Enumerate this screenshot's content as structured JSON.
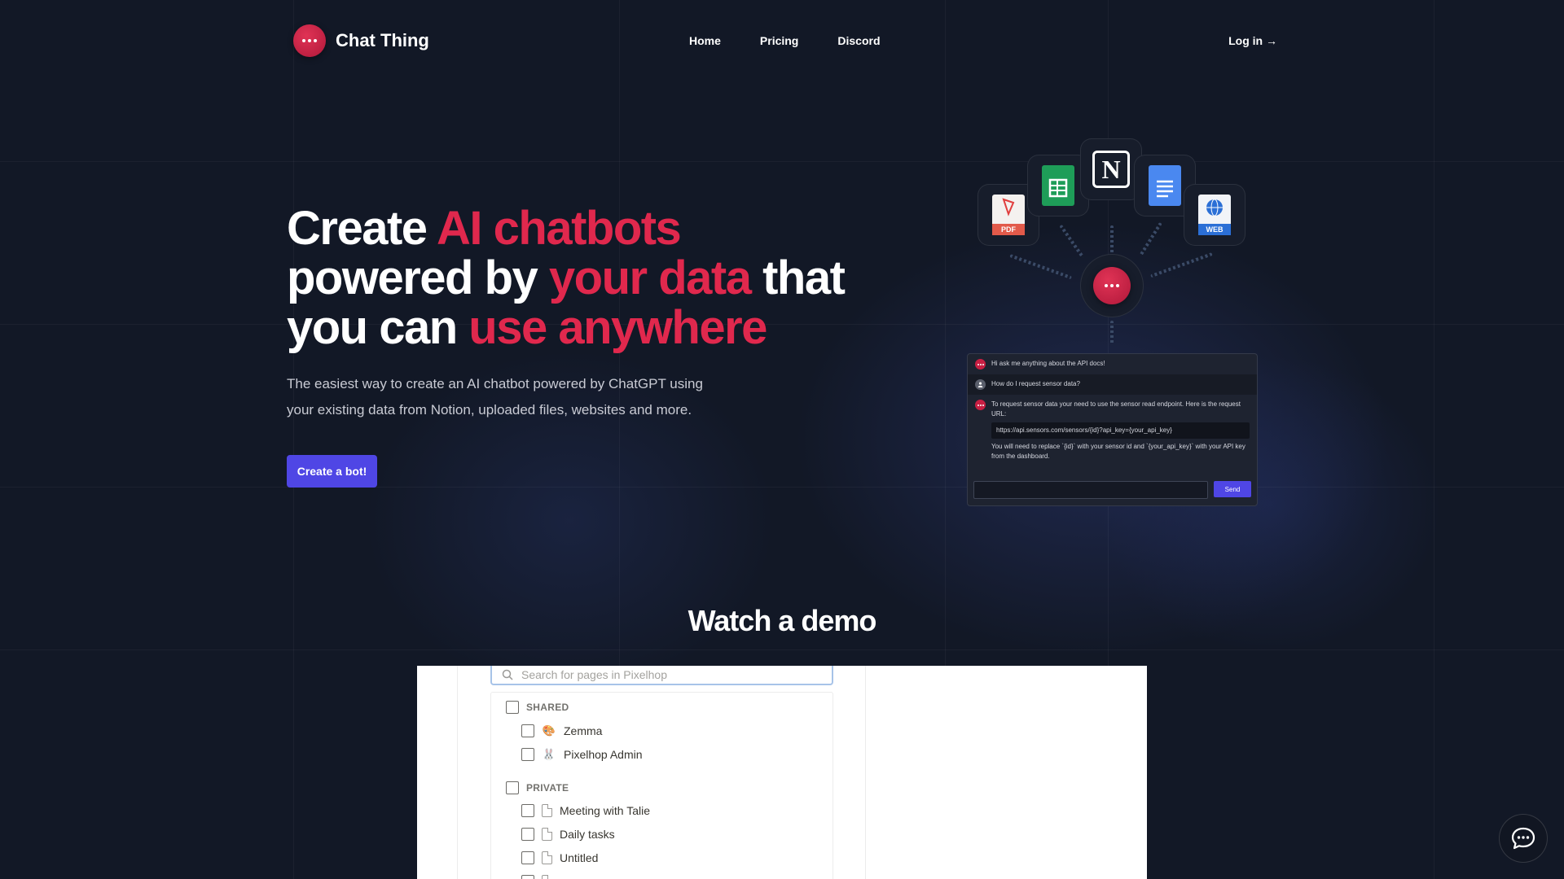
{
  "nav": {
    "brand": "Chat Thing",
    "links": [
      "Home",
      "Pricing",
      "Discord"
    ],
    "login": "Log in →"
  },
  "hero": {
    "title_line1_plain": "Create ",
    "title_line1_accent": "AI chatbots",
    "title_line2_plain": "powered by ",
    "title_line2_accent": "your data",
    "title_line2_tail": " that",
    "title_line3_plain": "you can ",
    "title_line3_accent": "use anywhere",
    "subtitle_line1": "The easiest way to create an AI chatbot powered by ChatGPT using",
    "subtitle_line2": "your existing data from Notion, uploaded files, websites and more.",
    "cta": "Create a bot!"
  },
  "integrations": {
    "pdf_label": "PDF",
    "web_label": "WEB",
    "notion_letter": "N",
    "icons": [
      "pdf-icon",
      "google-sheets-icon",
      "notion-icon",
      "google-docs-icon",
      "web-icon"
    ]
  },
  "chat_preview": {
    "messages": [
      {
        "role": "bot",
        "text": "Hi ask me anything about the API docs!"
      },
      {
        "role": "user",
        "text": "How do I request sensor data?"
      },
      {
        "role": "bot",
        "text": "To request sensor data your need to use the sensor read endpoint. Here is the request URL:"
      }
    ],
    "code": "https://api.sensors.com/sensors/{id}?api_key={your_api_key}",
    "followup": "You will need to replace `{id}` with your sensor id and `{your_api_key}` with your API key from the dashboard.",
    "send": "Send"
  },
  "demo": {
    "title": "Watch a demo",
    "search_placeholder": "Search for pages in Pixelhop",
    "shared_label": "SHARED",
    "private_label": "PRIVATE",
    "shared_items": [
      {
        "emoji": "🎨",
        "label": "Zemma"
      },
      {
        "emoji": "🐰",
        "label": "Pixelhop Admin"
      }
    ],
    "private_items": [
      "Meeting with Talie",
      "Daily tasks",
      "Untitled"
    ]
  },
  "colors": {
    "background": "#121826",
    "accent": "#e0284d",
    "button": "#4f46e5"
  }
}
